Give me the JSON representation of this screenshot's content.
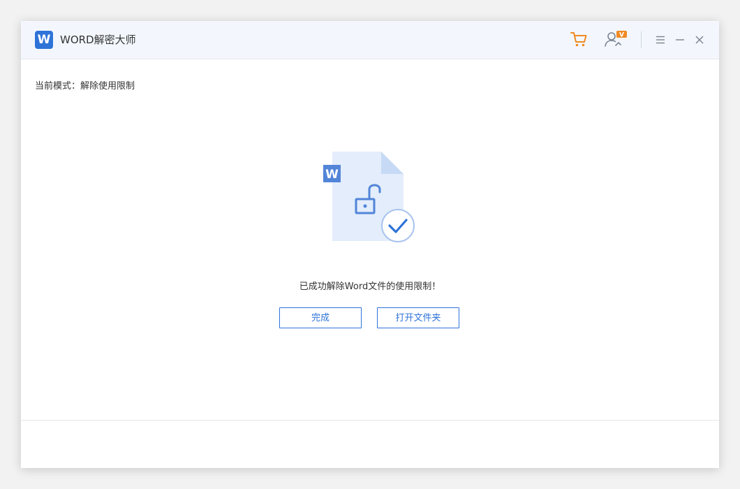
{
  "app": {
    "logo_letter": "W",
    "title": "WORD解密大师"
  },
  "toolbar": {
    "icons": [
      "cart-icon",
      "user-vip-icon",
      "menu-icon",
      "minimize-icon",
      "close-icon"
    ],
    "user_badge": "V"
  },
  "main": {
    "mode_label": "当前模式：解除使用限制",
    "illustration": {
      "doc_letter": "W",
      "icons": [
        "word-document-icon",
        "unlock-icon",
        "check-circle-icon"
      ]
    },
    "success_message": "已成功解除Word文件的使用限制！",
    "buttons": {
      "done": "完成",
      "open_folder": "打开文件夹"
    }
  },
  "colors": {
    "accent": "#2e73d8",
    "cart": "#f08a24",
    "titlebar_bg": "#f3f7fd",
    "doc_bg": "#e3edfb"
  }
}
